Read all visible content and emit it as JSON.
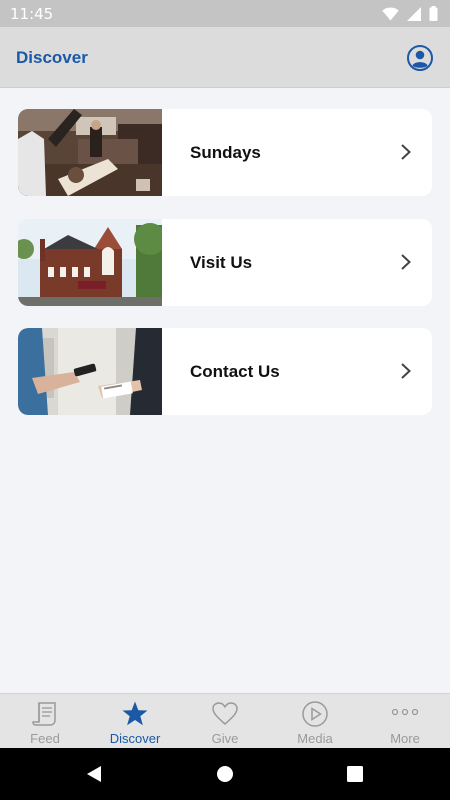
{
  "status_bar": {
    "time": "11:45",
    "icons": [
      "wifi-icon",
      "signal-icon",
      "battery-icon"
    ]
  },
  "header": {
    "title": "Discover",
    "profile_icon": "profile-icon"
  },
  "cards": [
    {
      "label": "Sundays",
      "image": "worship-service-photo",
      "icon": "chevron-right-icon"
    },
    {
      "label": "Visit Us",
      "image": "church-building-photo",
      "icon": "chevron-right-icon"
    },
    {
      "label": "Contact Us",
      "image": "phone-card-exchange-photo",
      "icon": "chevron-right-icon"
    }
  ],
  "tabs": [
    {
      "label": "Feed",
      "icon": "feed-scroll-icon",
      "active": false
    },
    {
      "label": "Discover",
      "icon": "star-icon",
      "active": true
    },
    {
      "label": "Give",
      "icon": "heart-icon",
      "active": false
    },
    {
      "label": "Media",
      "icon": "play-circle-icon",
      "active": false
    },
    {
      "label": "More",
      "icon": "more-dots-icon",
      "active": false
    }
  ],
  "navigation": [
    "back-icon",
    "home-icon",
    "recents-icon"
  ],
  "colors": {
    "accent": "#1b58a6",
    "tab_inactive": "#9a9a9a",
    "background": "#f3f4f8",
    "app_bar": "#dcdcdc"
  }
}
